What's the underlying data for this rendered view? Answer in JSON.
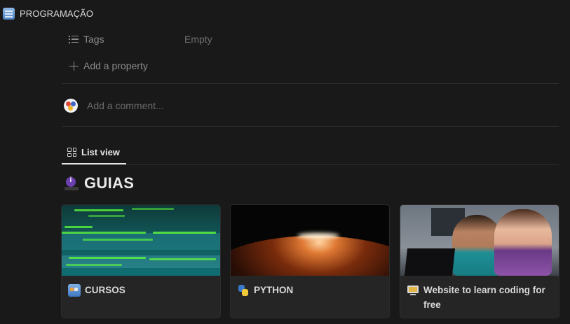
{
  "breadcrumb": {
    "title": "PROGRAMAÇÃO",
    "icon": "calendar-page-icon"
  },
  "properties": [
    {
      "icon": "list-icon",
      "label": "Tags",
      "value": "Empty"
    }
  ],
  "add_property": {
    "icon": "plus-icon",
    "label": "Add a property"
  },
  "comment": {
    "placeholder": "Add a comment..."
  },
  "view_tab": {
    "icon": "gallery-grid-icon",
    "label": "List view"
  },
  "section": {
    "title": "GUIAS",
    "icon": "info-badge-icon"
  },
  "cards": [
    {
      "title": "CURSOS",
      "icon": "books-icon",
      "cover": "green-code-terminal"
    },
    {
      "title": "PYTHON",
      "icon": "python-logo-icon",
      "cover": "planet-horizon-sunrise"
    },
    {
      "title": "Website to learn coding for free",
      "icon": "computer-icon",
      "cover": "surprised-people-at-laptop"
    }
  ],
  "colors": {
    "background": "#191919",
    "card": "#252525",
    "text": "#d4d4d4",
    "muted": "#8b8b8b",
    "divider": "#2f2f2f"
  }
}
